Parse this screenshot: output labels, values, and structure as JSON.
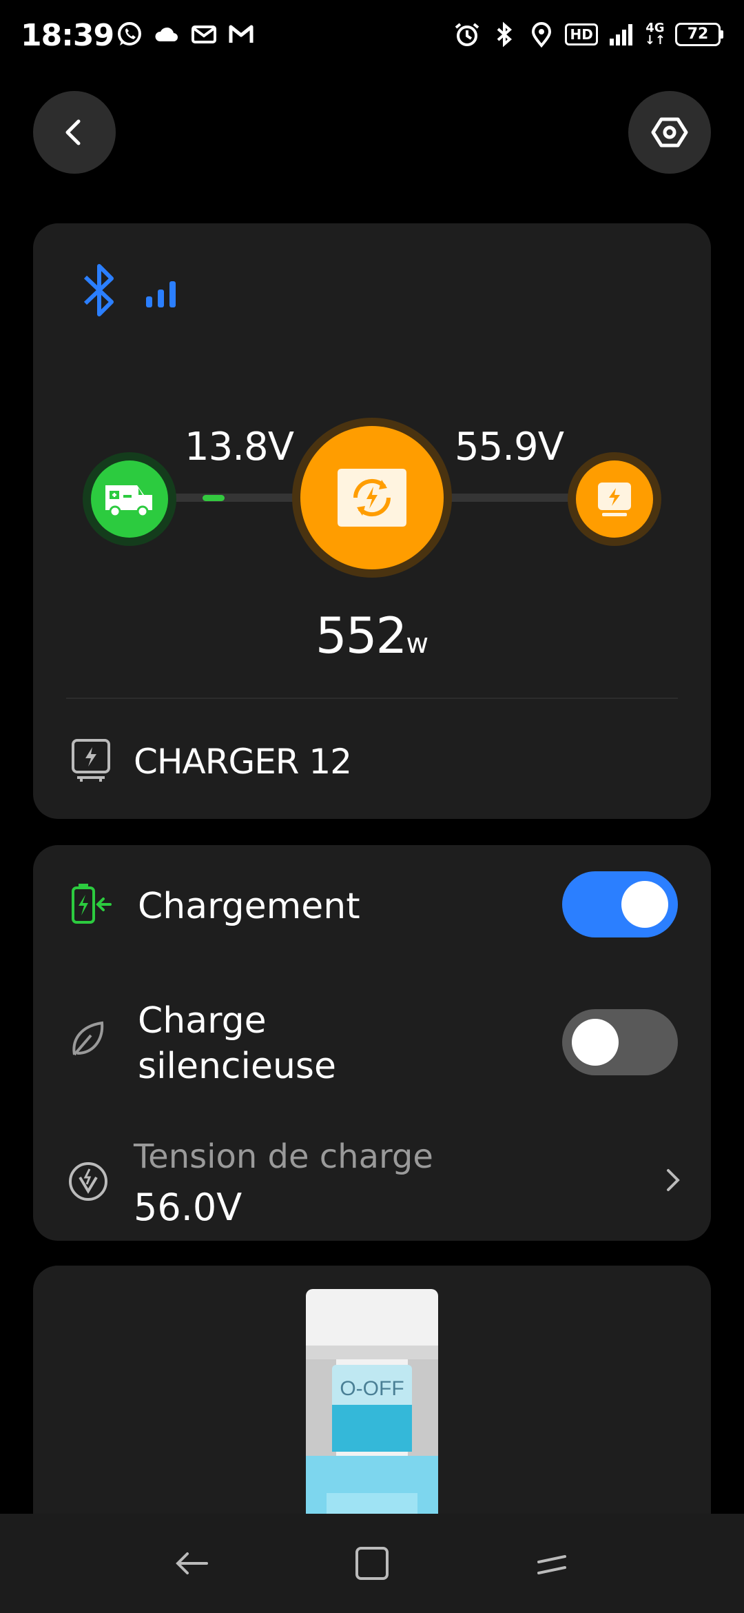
{
  "status_bar": {
    "time": "18:39",
    "left_icons": [
      "whatsapp-icon",
      "cloud-icon",
      "mail-icon",
      "gmail-icon"
    ],
    "right_icons": [
      "alarm-icon",
      "bluetooth-icon",
      "location-icon",
      "hd-icon",
      "signal-icon",
      "network-icon",
      "battery-icon"
    ],
    "hd_label": "HD",
    "network_label": "4G",
    "battery_level": "72"
  },
  "header": {
    "back_icon": "chevron-left-icon",
    "settings_icon": "hexagon-settings-icon"
  },
  "device_card": {
    "connection_icons": [
      "bluetooth-icon",
      "signal-bars-icon"
    ],
    "source_icon": "van-icon",
    "charger_icon": "charger-sync-icon",
    "output_icon": "power-station-icon",
    "input_voltage": "13.8V",
    "output_voltage": "55.9V",
    "power_value": "552",
    "power_unit": "w",
    "device_name": "CHARGER 12",
    "colors": {
      "source": "#2ccb3f",
      "charger": "#ff9d00",
      "flow": "#33c83f"
    }
  },
  "settings_card": {
    "charging": {
      "label": "Chargement",
      "enabled": true,
      "icon": "battery-charging-icon"
    },
    "silent": {
      "label_line1": "Charge",
      "label_line2": "silencieuse",
      "enabled": false,
      "icon": "leaf-icon"
    },
    "voltage": {
      "label": "Tension de charge",
      "value": "56.0V",
      "icon": "voltage-icon"
    },
    "accent": "#2b7fff"
  },
  "breaker_card": {
    "switch_label": "O-OFF"
  },
  "nav_bar": {
    "icons": [
      "back-nav-icon",
      "home-nav-icon",
      "recents-nav-icon"
    ]
  }
}
